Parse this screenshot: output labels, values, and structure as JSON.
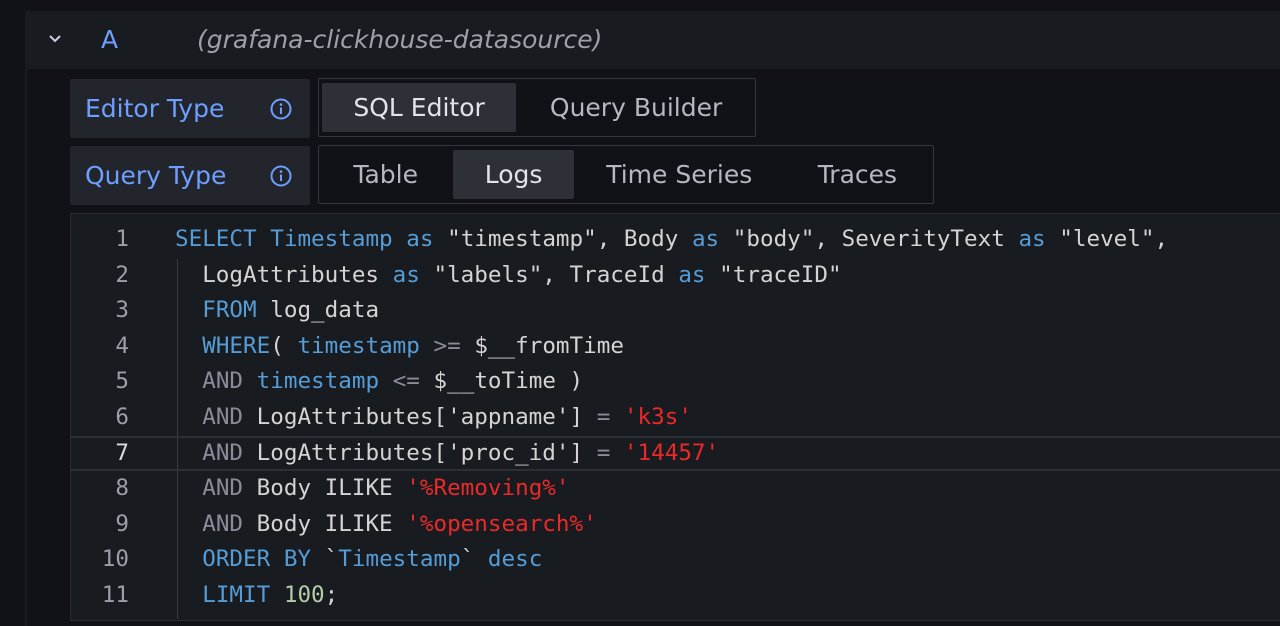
{
  "query_row": {
    "ref_id": "A",
    "datasource": "(grafana-clickhouse-datasource)"
  },
  "editor_type": {
    "label": "Editor Type",
    "options": [
      "SQL Editor",
      "Query Builder"
    ],
    "selected": "SQL Editor"
  },
  "query_type": {
    "label": "Query Type",
    "options": [
      "Table",
      "Logs",
      "Time Series",
      "Traces"
    ],
    "selected": "Logs"
  },
  "colors": {
    "keyword": "#569cd6",
    "string_literal": "#ea2a2a",
    "number": "#b5cea8",
    "label_accent": "#6e9fff"
  },
  "code_editor": {
    "current_line": "7",
    "lines": [
      {
        "n": "1",
        "tokens": [
          [
            "kw",
            "SELECT"
          ],
          [
            "t",
            " "
          ],
          [
            "kw",
            "Timestamp"
          ],
          [
            "t",
            " "
          ],
          [
            "kw",
            "as"
          ],
          [
            "t",
            " \"timestamp\", Body "
          ],
          [
            "kw",
            "as"
          ],
          [
            "t",
            " \"body\", SeverityText "
          ],
          [
            "kw",
            "as"
          ],
          [
            "t",
            " \"level\","
          ]
        ]
      },
      {
        "n": "2",
        "tokens": [
          [
            "t",
            "  LogAttributes "
          ],
          [
            "kw",
            "as"
          ],
          [
            "t",
            " \"labels\", TraceId "
          ],
          [
            "kw",
            "as"
          ],
          [
            "t",
            " \"traceID\""
          ]
        ]
      },
      {
        "n": "3",
        "tokens": [
          [
            "t",
            "  "
          ],
          [
            "kw",
            "FROM"
          ],
          [
            "t",
            " log_data"
          ]
        ]
      },
      {
        "n": "4",
        "tokens": [
          [
            "t",
            "  "
          ],
          [
            "kw",
            "WHERE"
          ],
          [
            "t",
            "( "
          ],
          [
            "kw",
            "timestamp"
          ],
          [
            "t",
            " "
          ],
          [
            "op",
            ">="
          ],
          [
            "t",
            " $__fromTime"
          ]
        ]
      },
      {
        "n": "5",
        "tokens": [
          [
            "t",
            "  "
          ],
          [
            "op",
            "AND"
          ],
          [
            "t",
            " "
          ],
          [
            "kw",
            "timestamp"
          ],
          [
            "t",
            " "
          ],
          [
            "op",
            "<="
          ],
          [
            "t",
            " $__toTime )"
          ]
        ]
      },
      {
        "n": "6",
        "tokens": [
          [
            "t",
            "  "
          ],
          [
            "op",
            "AND"
          ],
          [
            "t",
            " LogAttributes['appname'] "
          ],
          [
            "op",
            "="
          ],
          [
            "t",
            " "
          ],
          [
            "str",
            "'k3s'"
          ]
        ]
      },
      {
        "n": "7",
        "tokens": [
          [
            "t",
            "  "
          ],
          [
            "op",
            "AND"
          ],
          [
            "t",
            " LogAttributes['proc_id'] "
          ],
          [
            "op",
            "="
          ],
          [
            "t",
            " "
          ],
          [
            "str",
            "'14457'"
          ]
        ]
      },
      {
        "n": "8",
        "tokens": [
          [
            "t",
            "  "
          ],
          [
            "op",
            "AND"
          ],
          [
            "t",
            " Body ILIKE "
          ],
          [
            "str",
            "'%Removing%'"
          ]
        ]
      },
      {
        "n": "9",
        "tokens": [
          [
            "t",
            "  "
          ],
          [
            "op",
            "AND"
          ],
          [
            "t",
            " Body ILIKE "
          ],
          [
            "str",
            "'%opensearch%'"
          ]
        ]
      },
      {
        "n": "10",
        "tokens": [
          [
            "t",
            "  "
          ],
          [
            "kw",
            "ORDER BY"
          ],
          [
            "t",
            " `"
          ],
          [
            "kw",
            "Timestamp"
          ],
          [
            "t",
            "` "
          ],
          [
            "kw",
            "desc"
          ]
        ]
      },
      {
        "n": "11",
        "tokens": [
          [
            "t",
            "  "
          ],
          [
            "kw",
            "LIMIT"
          ],
          [
            "t",
            " "
          ],
          [
            "num",
            "100"
          ],
          [
            "t",
            ";"
          ]
        ]
      }
    ]
  }
}
